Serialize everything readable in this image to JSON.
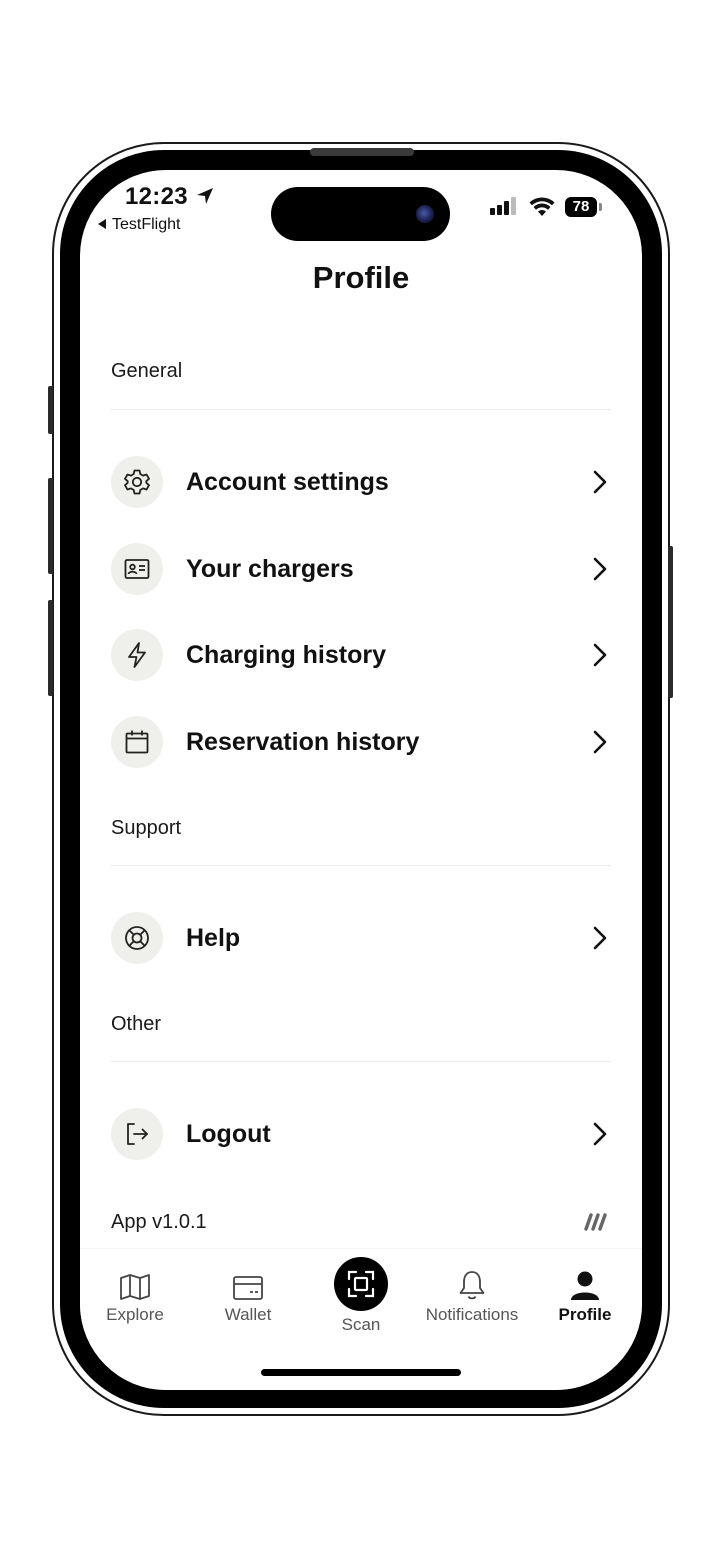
{
  "status_bar": {
    "time": "12:23",
    "back_app": "TestFlight",
    "battery": "78"
  },
  "header": {
    "title": "Profile"
  },
  "sections": {
    "general": {
      "label": "General",
      "items": [
        {
          "label": "Account settings",
          "icon": "gear-icon"
        },
        {
          "label": "Your chargers",
          "icon": "id-card-icon"
        },
        {
          "label": "Charging history",
          "icon": "lightning-icon"
        },
        {
          "label": "Reservation history",
          "icon": "calendar-icon"
        }
      ]
    },
    "support": {
      "label": "Support",
      "items": [
        {
          "label": "Help",
          "icon": "lifebuoy-icon"
        }
      ]
    },
    "other": {
      "label": "Other",
      "items": [
        {
          "label": "Logout",
          "icon": "logout-icon"
        }
      ]
    }
  },
  "footer": {
    "version": "App v1.0.1"
  },
  "tabbar": {
    "tabs": [
      {
        "label": "Explore",
        "icon": "map-icon",
        "active": false
      },
      {
        "label": "Wallet",
        "icon": "wallet-card-icon",
        "active": false
      },
      {
        "label": "Scan",
        "icon": "scan-icon",
        "active": false
      },
      {
        "label": "Notifications",
        "icon": "bell-icon",
        "active": false
      },
      {
        "label": "Profile",
        "icon": "person-icon",
        "active": true
      }
    ]
  },
  "colors": {
    "icon_bg": "#efefeb",
    "text": "#111111",
    "inactive_tab": "#555555"
  }
}
